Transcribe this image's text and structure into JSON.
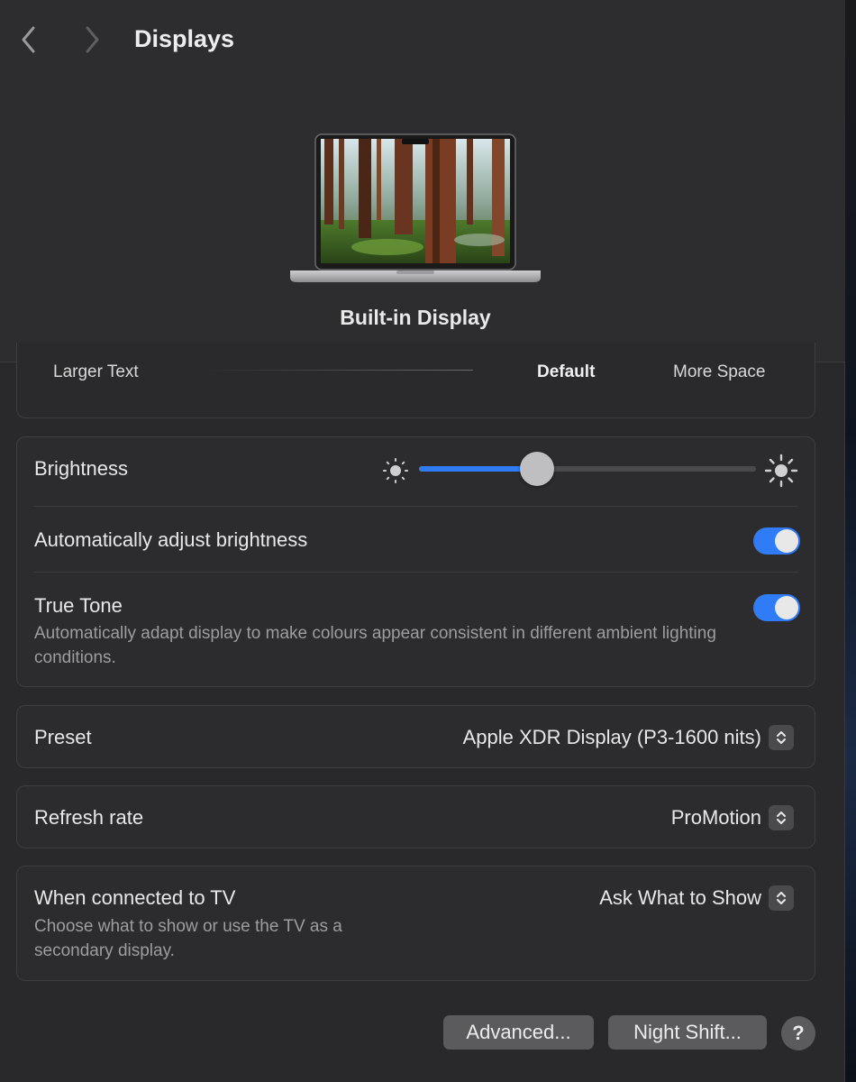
{
  "header": {
    "title": "Displays",
    "back_icon": "chevron-left-icon",
    "forward_icon": "chevron-right-icon",
    "display_name": "Built-in Display"
  },
  "resolution": {
    "left_label": "Larger Text",
    "middle_label": "Default",
    "right_label": "More Space"
  },
  "brightness": {
    "label": "Brightness",
    "value_percent": 35,
    "low_icon": "sun-small-icon",
    "high_icon": "sun-large-icon"
  },
  "auto_brightness": {
    "label": "Automatically adjust brightness",
    "enabled": true
  },
  "true_tone": {
    "label": "True Tone",
    "description": "Automatically adapt display to make colours appear consistent in different ambient lighting conditions.",
    "enabled": true
  },
  "preset": {
    "label": "Preset",
    "value": "Apple XDR Display (P3-1600 nits)"
  },
  "refresh_rate": {
    "label": "Refresh rate",
    "value": "ProMotion"
  },
  "tv": {
    "label": "When connected to TV",
    "description": "Choose what to show or use the TV as a secondary display.",
    "value": "Ask What to Show"
  },
  "buttons": {
    "advanced": "Advanced...",
    "night_shift": "Night Shift...",
    "help": "?"
  },
  "colors": {
    "accent": "#2f7cf6",
    "background": "#29292b",
    "card": "#2c2c2e"
  }
}
